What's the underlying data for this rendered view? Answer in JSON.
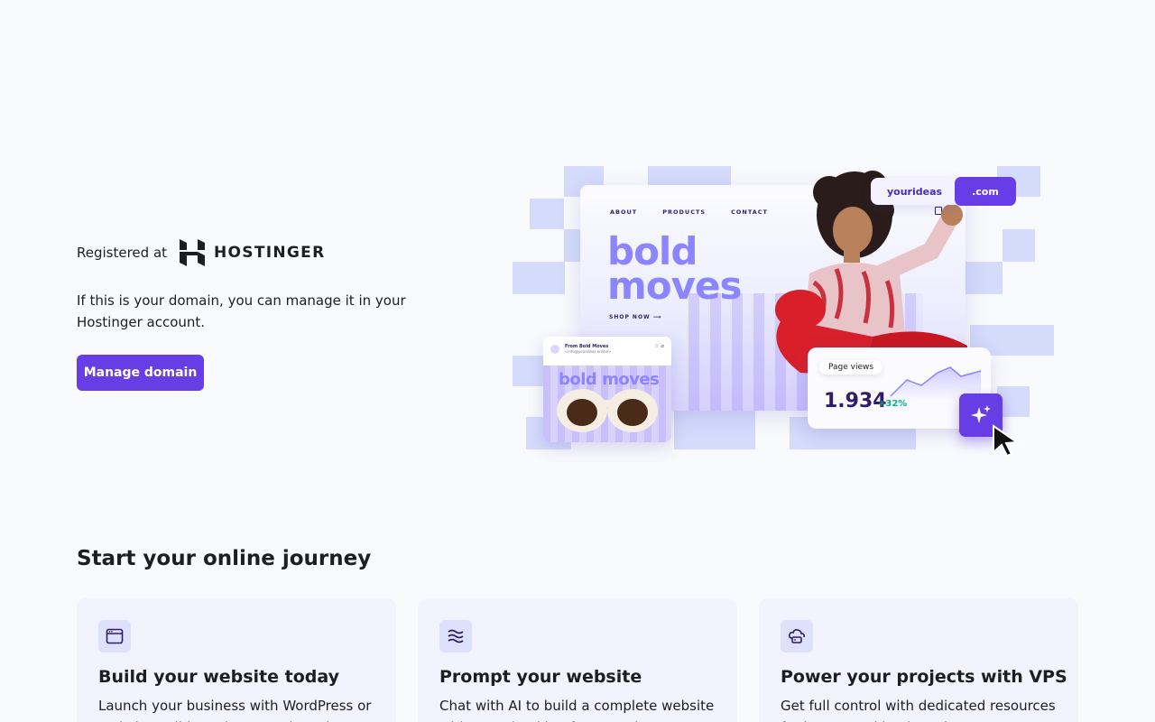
{
  "registrar": {
    "label": "Registered at",
    "brand": "HOSTINGER",
    "logo_icon": "hostinger-logo-icon"
  },
  "description": "If this is your domain, you can manage it in your Hostinger account.",
  "manage_button": "Manage domain",
  "hero": {
    "nav": [
      "ABOUT",
      "PRODUCTS",
      "CONTACT"
    ],
    "headline_line1": "bold",
    "headline_line2": "moves",
    "shop_now": "SHOP NOW",
    "domain_name": "yourideas",
    "domain_tld": ".com",
    "mail_from": "From Bold Moves",
    "mail_address": "<info@yourideas.online>",
    "mail_banner": "bold moves",
    "stats_label": "Page views",
    "stats_value": "1.934",
    "stats_change": "+32%"
  },
  "section": {
    "title": "Start your online journey",
    "cards": [
      {
        "icon": "browser-window-icon",
        "title": "Build your website today",
        "text": "Launch your business with WordPress or Website Builder using AI tools and"
      },
      {
        "icon": "ai-waves-icon",
        "title": "Prompt your website",
        "text": "Chat with AI to build a complete website with CRM, booking forms and more"
      },
      {
        "icon": "cloud-server-icon",
        "title": "Power your projects with VPS",
        "text": "Get full control with dedicated resources for heavy workloads and"
      }
    ]
  },
  "colors": {
    "brand": "#673de6",
    "background": "#f9fafd",
    "card": "#f2f3fc",
    "accent_light": "#d5dbfb",
    "positive": "#00b090"
  }
}
